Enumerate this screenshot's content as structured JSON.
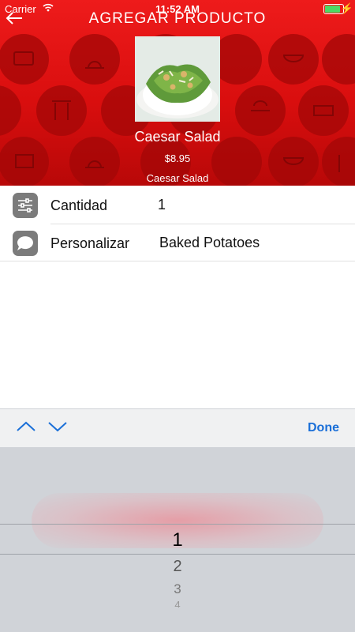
{
  "status_bar": {
    "carrier": "Carrier",
    "time": "11:52 AM"
  },
  "nav": {
    "title": "AGREGAR PRODUCTO"
  },
  "product": {
    "name": "Caesar Salad",
    "price": "$8.95",
    "description": "Caesar Salad"
  },
  "rows": [
    {
      "label": "Cantidad",
      "value": "1",
      "icon": "sliders-icon"
    },
    {
      "label": "Personalizar",
      "value": "Baked Potatoes",
      "icon": "chat-bubble-icon"
    }
  ],
  "accessory": {
    "done_label": "Done"
  },
  "picker": {
    "options": [
      "1",
      "2",
      "3",
      "4"
    ],
    "selected": "1"
  },
  "colors": {
    "header_red": "#e31414",
    "accent_blue": "#1a6fd8",
    "icon_gray": "#7b7b7b",
    "picker_bg": "#d0d3d8"
  }
}
